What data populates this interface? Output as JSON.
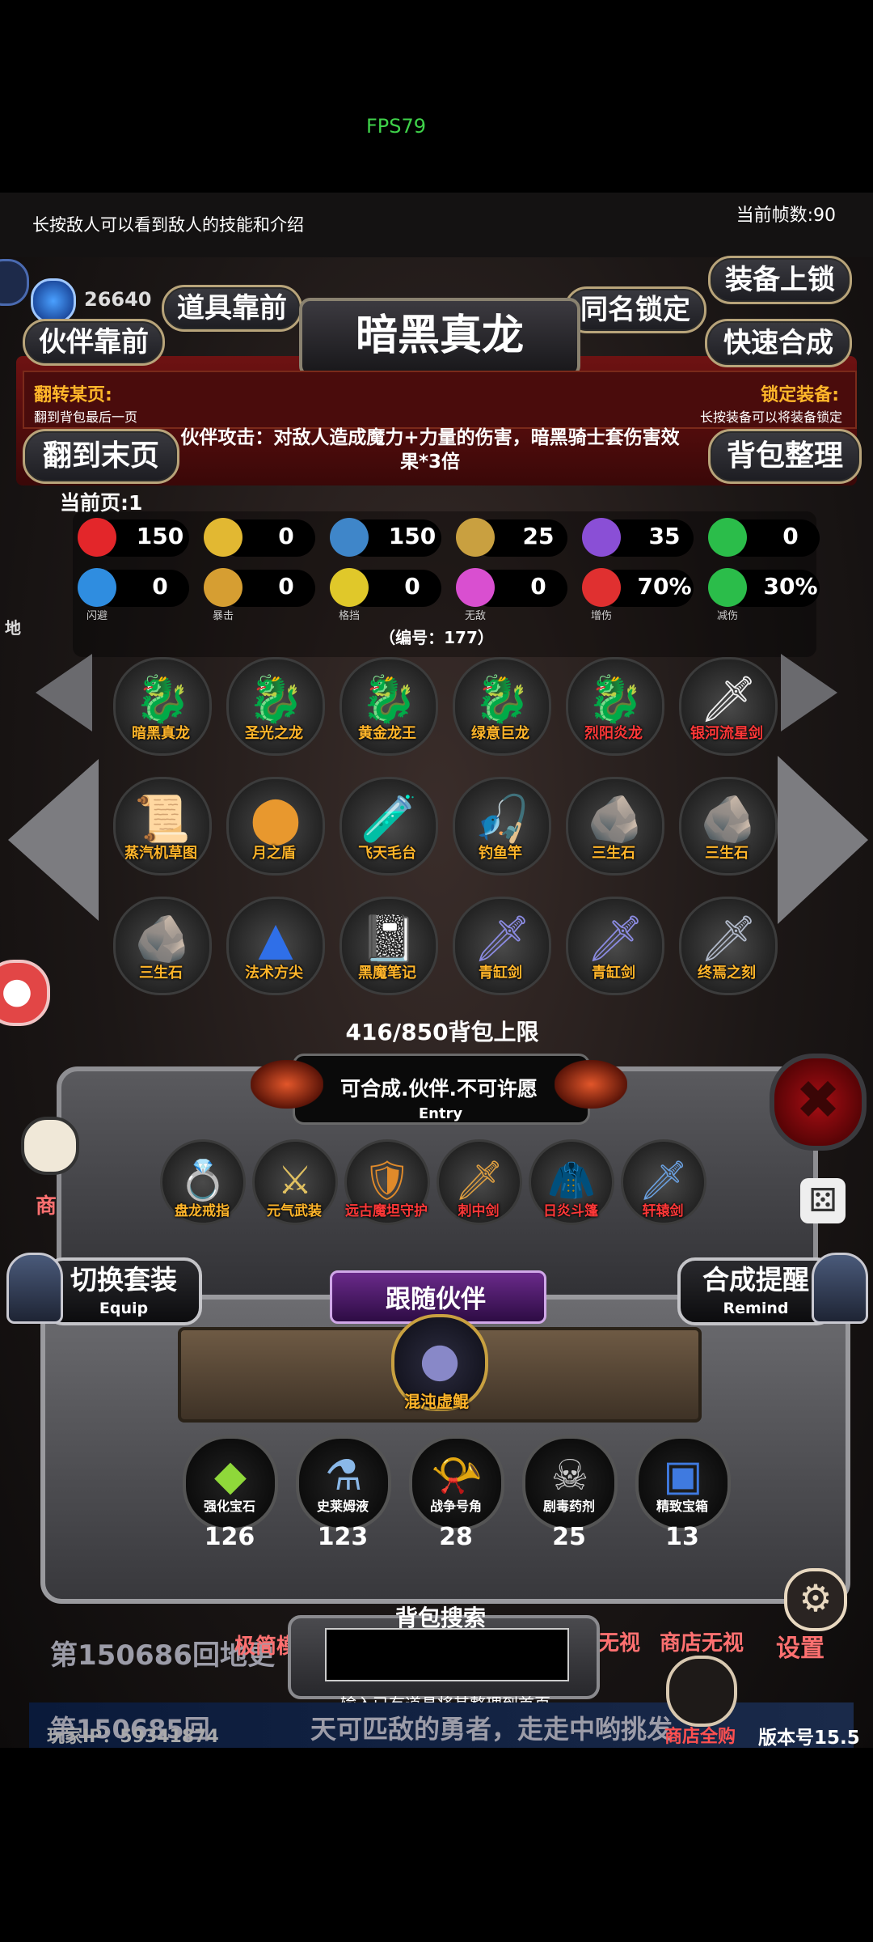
{
  "fps": "FPS79",
  "hint": "长按敌人可以看到敌人的技能和介绍",
  "frame_count": "当前帧数:90",
  "gold": "26640",
  "buttons": {
    "items_first": "道具靠前",
    "partner_first": "伙伴靠前",
    "same_name_lock": "同名锁定",
    "equip_lock": "装备上锁",
    "quick_merge": "快速合成",
    "to_last_page": "翻到末页",
    "bag_sort": "背包整理"
  },
  "title": "暗黑真龙",
  "flip_page": {
    "label": "翻转某页:",
    "sub": "翻到背包最后一页"
  },
  "lock_equip": {
    "label": "锁定装备:",
    "sub": "长按装备可以将装备锁定"
  },
  "description": "伙伴攻击：对敌人造成魔力+力量的伤害，暗黑骑士套伤害效果*3倍",
  "current_page": "当前页:1",
  "stats_row1": [
    {
      "icon": "heart-icon",
      "value": "150",
      "color": "#e3262a"
    },
    {
      "icon": "strength-icon",
      "value": "0",
      "color": "#e2b832"
    },
    {
      "icon": "helmet-icon",
      "value": "150",
      "color": "#3f86c9"
    },
    {
      "icon": "horn-icon",
      "value": "25",
      "color": "#c9a040"
    },
    {
      "icon": "lightning-icon",
      "value": "35",
      "color": "#8a4fd6"
    },
    {
      "icon": "clover-icon",
      "value": "0",
      "color": "#2bbd4a"
    }
  ],
  "stats_row2": [
    {
      "icon": "dodge-icon",
      "value": "0",
      "label": "闪避",
      "color": "#2f8de0"
    },
    {
      "icon": "crit-icon",
      "value": "0",
      "label": "暴击",
      "color": "#d69e32"
    },
    {
      "icon": "block-icon",
      "value": "0",
      "label": "格挡",
      "color": "#e0c82a"
    },
    {
      "icon": "invincible-icon",
      "value": "0",
      "label": "无敌",
      "color": "#d94fd0"
    },
    {
      "icon": "damage-up-icon",
      "value": "70%",
      "label": "增伤",
      "color": "#e03030"
    },
    {
      "icon": "damage-down-icon",
      "value": "30%",
      "label": "减伤",
      "color": "#2bbd4a"
    }
  ],
  "item_id": "（编号：177）",
  "inventory": [
    {
      "name": "暗黑真龙",
      "art": "🐉",
      "art_color": "#bfe3ff",
      "red": false
    },
    {
      "name": "圣光之龙",
      "art": "🐉",
      "art_color": "#f3c23a",
      "red": false
    },
    {
      "name": "黄金龙王",
      "art": "🐉",
      "art_color": "#e0922a",
      "red": false
    },
    {
      "name": "绿意巨龙",
      "art": "🐉",
      "art_color": "#3fc04a",
      "red": false
    },
    {
      "name": "烈阳炎龙",
      "art": "🐉",
      "art_color": "#e0452a",
      "red": true
    },
    {
      "name": "银河流星剑",
      "art": "🗡",
      "art_color": "#f0f0f0",
      "red": true
    },
    {
      "name": "蒸汽机草图",
      "art": "📜",
      "art_color": "#e8d8b0",
      "red": false
    },
    {
      "name": "月之盾",
      "art": "⬤",
      "art_color": "#e8982e",
      "red": false
    },
    {
      "name": "飞天毛台",
      "art": "🧪",
      "art_color": "#3fcfa8",
      "red": false
    },
    {
      "name": "钓鱼竿",
      "art": "🎣",
      "art_color": "#caa060",
      "red": false
    },
    {
      "name": "三生石",
      "art": "🪨",
      "art_color": "#9a9a9a",
      "red": false
    },
    {
      "name": "三生石",
      "art": "🪨",
      "art_color": "#9a9a9a",
      "red": false
    },
    {
      "name": "三生石",
      "art": "🪨",
      "art_color": "#9a9a9a",
      "red": false
    },
    {
      "name": "法术方尖",
      "art": "▲",
      "art_color": "#2f6fe8",
      "red": false
    },
    {
      "name": "黑魔笔记",
      "art": "📓",
      "art_color": "#888",
      "red": false
    },
    {
      "name": "青缸剑",
      "art": "🗡",
      "art_color": "#8a8ae0",
      "red": false
    },
    {
      "name": "青缸剑",
      "art": "🗡",
      "art_color": "#8a8ae0",
      "red": false
    },
    {
      "name": "终焉之刻",
      "art": "🗡",
      "art_color": "#b0b8c8",
      "red": false
    }
  ],
  "bag_capacity": "416/850背包上限",
  "entry": {
    "text": "可合成.伙伴.不可许愿",
    "label": "Entry"
  },
  "equipment": [
    {
      "name": "盘龙戒指",
      "art": "💍",
      "art_color": "#999"
    },
    {
      "name": "元气武装",
      "art": "⚔",
      "art_color": "#e0c060"
    },
    {
      "name": "远古魔坦守护",
      "art": "🛡",
      "art_color": "#e08a2a",
      "red": true
    },
    {
      "name": "刺中剑",
      "art": "🗡",
      "art_color": "#e0a040",
      "red": true
    },
    {
      "name": "日炎斗篷",
      "art": "🧥",
      "art_color": "#e0452a",
      "red": true
    },
    {
      "name": "轩辕剑",
      "art": "🗡",
      "art_color": "#6aa0e0",
      "red": true
    }
  ],
  "switch_set": {
    "label": "切换套装",
    "sub": "Equip"
  },
  "merge_remind": {
    "label": "合成提醒",
    "sub": "Remind"
  },
  "follow_partner": {
    "label": "跟随伙伴",
    "name": "混沌虚鲲"
  },
  "materials": [
    {
      "name": "强化宝石",
      "count": "126",
      "art": "◆",
      "art_color": "#8fd83a"
    },
    {
      "name": "史莱姆液",
      "count": "123",
      "art": "⚗",
      "art_color": "#8ab8e8"
    },
    {
      "name": "战争号角",
      "count": "28",
      "art": "📯",
      "art_color": "#d08ad0"
    },
    {
      "name": "剧毒药剂",
      "count": "25",
      "art": "☠",
      "art_color": "#cccccc"
    },
    {
      "name": "精致宝箱",
      "count": "13",
      "art": "▣",
      "art_color": "#3f7ae0"
    }
  ],
  "search": {
    "label": "背包搜索",
    "hint": "输入已有道具将其整理到首页"
  },
  "background": {
    "level_text": "第150686回地更",
    "level_text2": "第150685回",
    "scroll": "天可匹敌的勇者，走走中哟挑发",
    "simplify": "极简模",
    "no_look": "无视",
    "shop_no_look": "商店无视",
    "settings": "设置",
    "shop_all": "商店全购",
    "shop": "商",
    "map": "地"
  },
  "player_ip": "玩家IP：59341874",
  "version": "版本号15.5"
}
